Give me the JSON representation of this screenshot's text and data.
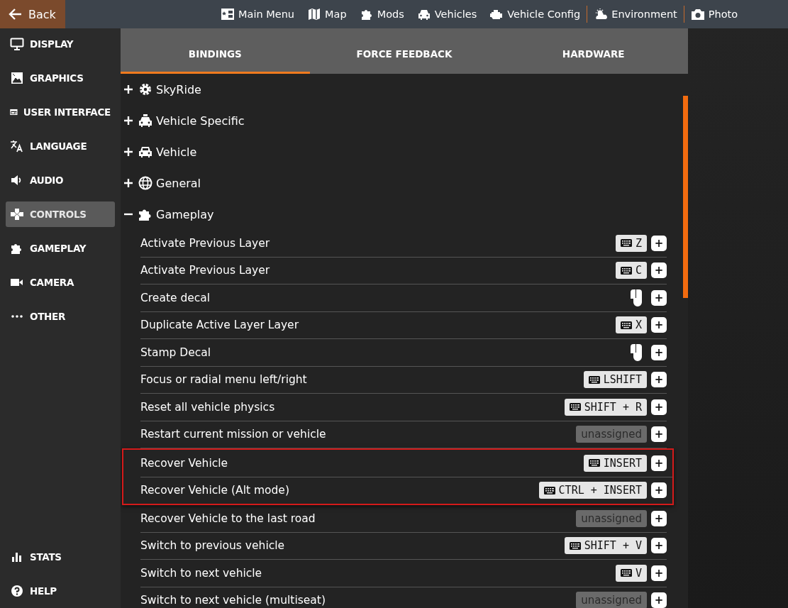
{
  "back": "Back",
  "nav_groups": [
    [
      {
        "label": "Main Menu"
      },
      {
        "label": "Map"
      },
      {
        "label": "Mods"
      },
      {
        "label": "Vehicles"
      },
      {
        "label": "Vehicle Config"
      }
    ],
    [
      {
        "label": "Environment"
      }
    ],
    [
      {
        "label": "Photo"
      }
    ]
  ],
  "sidebar": {
    "items": [
      {
        "label": "DISPLAY",
        "selected": false
      },
      {
        "label": "GRAPHICS",
        "selected": false
      },
      {
        "label": "USER INTERFACE",
        "selected": false
      },
      {
        "label": "LANGUAGE",
        "selected": false
      },
      {
        "label": "AUDIO",
        "selected": false
      },
      {
        "label": "CONTROLS",
        "selected": true
      },
      {
        "label": "GAMEPLAY",
        "selected": false
      },
      {
        "label": "CAMERA",
        "selected": false
      },
      {
        "label": "OTHER",
        "selected": false
      }
    ],
    "bottom_items": [
      {
        "label": "STATS"
      },
      {
        "label": "HELP"
      }
    ]
  },
  "tabs": [
    {
      "label": "BINDINGS",
      "selected": true
    },
    {
      "label": "FORCE FEEDBACK",
      "selected": false
    },
    {
      "label": "HARDWARE",
      "selected": false
    }
  ],
  "categories": [
    {
      "name": "SkyRide",
      "expanded": false
    },
    {
      "name": "Vehicle Specific",
      "expanded": false
    },
    {
      "name": "Vehicle",
      "expanded": false
    },
    {
      "name": "General",
      "expanded": false
    },
    {
      "name": "Gameplay",
      "expanded": true,
      "actions": [
        {
          "name": "Activate Previous Layer",
          "highlighted": false,
          "binding": {
            "kind": "keyboard",
            "text": "Z"
          }
        },
        {
          "name": "Activate Previous Layer",
          "highlighted": false,
          "binding": {
            "kind": "keyboard",
            "text": "C"
          }
        },
        {
          "name": "Create decal",
          "highlighted": false,
          "binding": {
            "kind": "mouse"
          }
        },
        {
          "name": "Duplicate Active Layer Layer",
          "highlighted": false,
          "binding": {
            "kind": "keyboard",
            "text": "X"
          }
        },
        {
          "name": "Stamp Decal",
          "highlighted": false,
          "binding": {
            "kind": "mouse"
          }
        },
        {
          "name": "Focus or radial menu left/right",
          "highlighted": false,
          "binding": {
            "kind": "keyboard",
            "text": "LSHIFT"
          }
        },
        {
          "name": "Reset all vehicle physics",
          "highlighted": false,
          "binding": {
            "kind": "keyboard",
            "text": "SHIFT + R"
          }
        },
        {
          "name": "Restart current mission or vehicle",
          "highlighted": false,
          "binding": {
            "kind": "unassigned",
            "text": "unassigned"
          }
        },
        {
          "name": "Recover Vehicle",
          "highlighted": true,
          "binding": {
            "kind": "keyboard",
            "text": "INSERT"
          }
        },
        {
          "name": "Recover Vehicle (Alt mode)",
          "highlighted": true,
          "binding": {
            "kind": "keyboard",
            "text": "CTRL + INSERT"
          }
        },
        {
          "name": "Recover Vehicle to the last road",
          "highlighted": false,
          "binding": {
            "kind": "unassigned",
            "text": "unassigned"
          }
        },
        {
          "name": "Switch to previous vehicle",
          "highlighted": false,
          "binding": {
            "kind": "keyboard",
            "text": "SHIFT + V"
          }
        },
        {
          "name": "Switch to next vehicle",
          "highlighted": false,
          "binding": {
            "kind": "keyboard",
            "text": "V"
          }
        },
        {
          "name": "Switch to next vehicle (multiseat)",
          "highlighted": false,
          "binding": {
            "kind": "unassigned",
            "text": "unassigned"
          }
        }
      ]
    }
  ],
  "add_button": "+"
}
